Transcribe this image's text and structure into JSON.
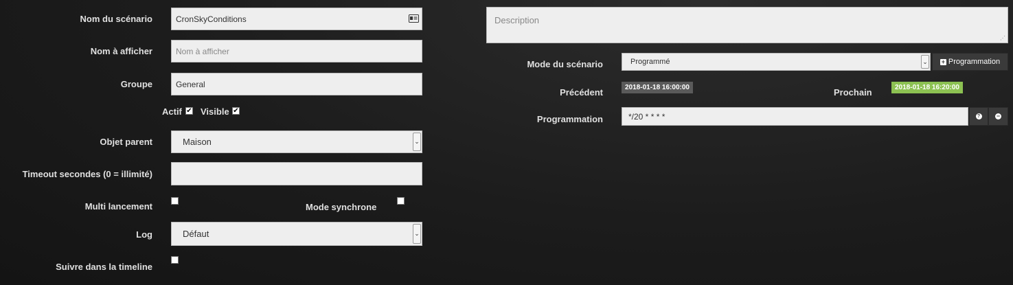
{
  "form": {
    "scenario_name_label": "Nom du scénario",
    "scenario_name_value": "CronSkyConditions",
    "display_name_label": "Nom à afficher",
    "display_name_placeholder": "Nom à afficher",
    "group_label": "Groupe",
    "group_value": "General",
    "active_label": "Actif",
    "active_checked": true,
    "visible_label": "Visible",
    "visible_checked": true,
    "parent_object_label": "Objet parent",
    "parent_object_value": "Maison",
    "timeout_label": "Timeout secondes (0 = illimité)",
    "timeout_value": "",
    "multi_launch_label": "Multi lancement",
    "multi_launch_checked": false,
    "sync_mode_label": "Mode synchrone",
    "sync_mode_checked": false,
    "log_label": "Log",
    "log_value": "Défaut",
    "timeline_label": "Suivre dans la timeline",
    "timeline_checked": false
  },
  "right": {
    "description_placeholder": "Description",
    "mode_label": "Mode du scénario",
    "mode_value": "Programmé",
    "add_programmation_label": "Programmation",
    "previous_label": "Précédent",
    "previous_value": "2018-01-18 16:00:00",
    "next_label": "Prochain",
    "next_value": "2018-01-18 16:20:00",
    "programmation_label": "Programmation",
    "programmation_value": "*/20 * * * *"
  },
  "colors": {
    "previous_badge": "#5a5a5a",
    "next_badge": "#8cc152"
  },
  "icons": [
    "id-card-icon",
    "plus-square-icon",
    "help-icon",
    "minus-icon",
    "resize-grip-icon",
    "chevron-down-icon",
    "checkmark-icon"
  ]
}
